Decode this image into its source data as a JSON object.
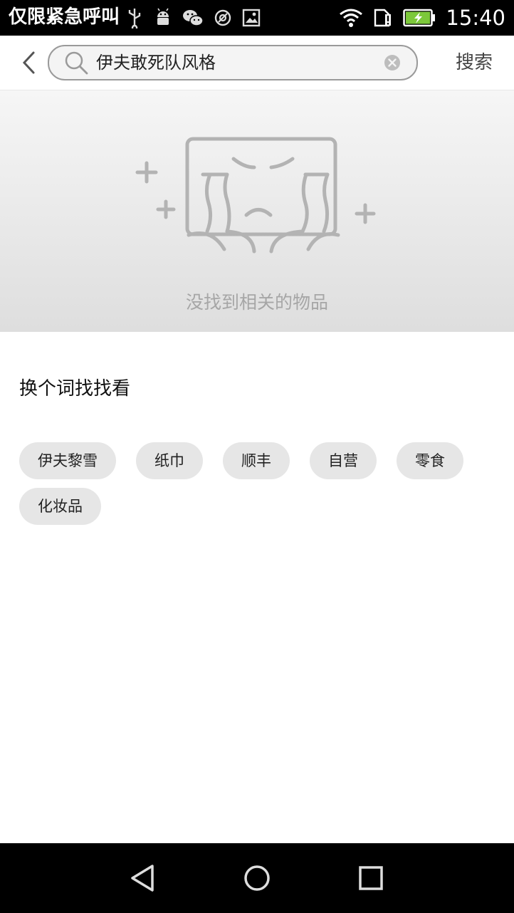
{
  "status_bar": {
    "carrier": "仅限紧急呼叫",
    "time": "15:40",
    "left_icons": [
      "usb-icon",
      "android-debug-icon",
      "wechat-icon",
      "sync-icon",
      "image-icon"
    ],
    "right_icons": [
      "wifi-icon",
      "sim-alert-icon",
      "battery-charging-icon"
    ]
  },
  "header": {
    "back_icon": "chevron-left-icon",
    "search_icon": "search-icon",
    "query": "伊夫敢死队风格",
    "clear_icon": "clear-icon",
    "search_button": "搜索"
  },
  "empty_state": {
    "illustration": "crying-box-icon",
    "message": "没找到相关的物品"
  },
  "suggestions": {
    "title": "换个词找找看",
    "chips": [
      "伊夫黎雪",
      "纸巾",
      "顺丰",
      "自营",
      "零食",
      "化妆品"
    ]
  },
  "nav_bar": {
    "buttons": [
      "nav-back-icon",
      "nav-home-icon",
      "nav-recents-icon"
    ]
  }
}
